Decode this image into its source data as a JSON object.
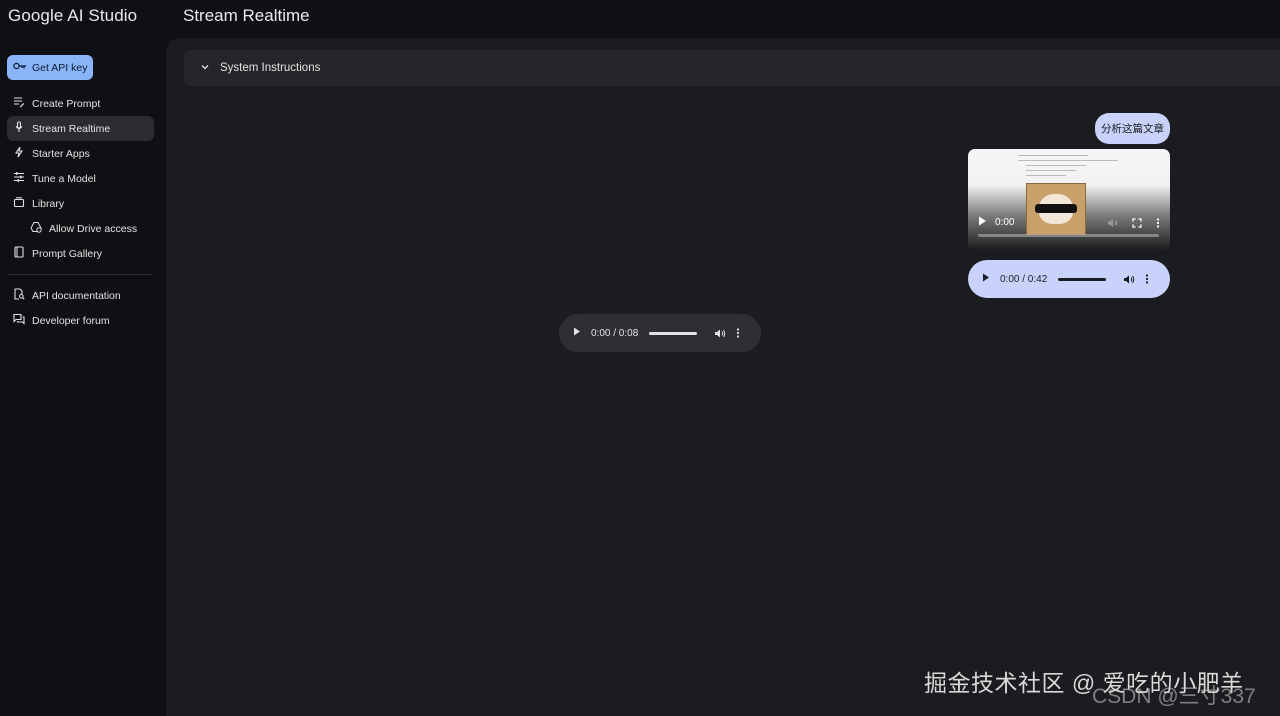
{
  "app": {
    "brand": "Google AI Studio",
    "page_title": "Stream Realtime"
  },
  "sidebar": {
    "api_button": "Get API key",
    "items": [
      {
        "label": "Create Prompt",
        "icon": "edit-note-icon"
      },
      {
        "label": "Stream Realtime",
        "icon": "mic-icon",
        "active": true
      },
      {
        "label": "Starter Apps",
        "icon": "bolt-icon"
      },
      {
        "label": "Tune a Model",
        "icon": "tune-icon"
      },
      {
        "label": "Library",
        "icon": "library-icon"
      },
      {
        "label": "Allow Drive access",
        "icon": "drive-icon",
        "sub": true
      },
      {
        "label": "Prompt Gallery",
        "icon": "book-icon"
      }
    ],
    "footer_items": [
      {
        "label": "API documentation",
        "icon": "doc-search-icon"
      },
      {
        "label": "Developer forum",
        "icon": "forum-icon"
      }
    ]
  },
  "main": {
    "system_instructions": "System Instructions",
    "user_message": "分析这篇文章",
    "video": {
      "time": "0:00"
    },
    "user_audio": {
      "time": "0:00 / 0:42"
    },
    "model_audio": {
      "time": "0:00 / 0:08"
    }
  },
  "watermark": {
    "main": "掘金技术社区 @ 爱吃的小肥羊",
    "secondary": "CSDN @三寸337"
  },
  "colors": {
    "accent": "#8ab4f8",
    "bubble": "#c8d2fb",
    "panel": "#1b1c1f",
    "background": "#0f1013"
  }
}
